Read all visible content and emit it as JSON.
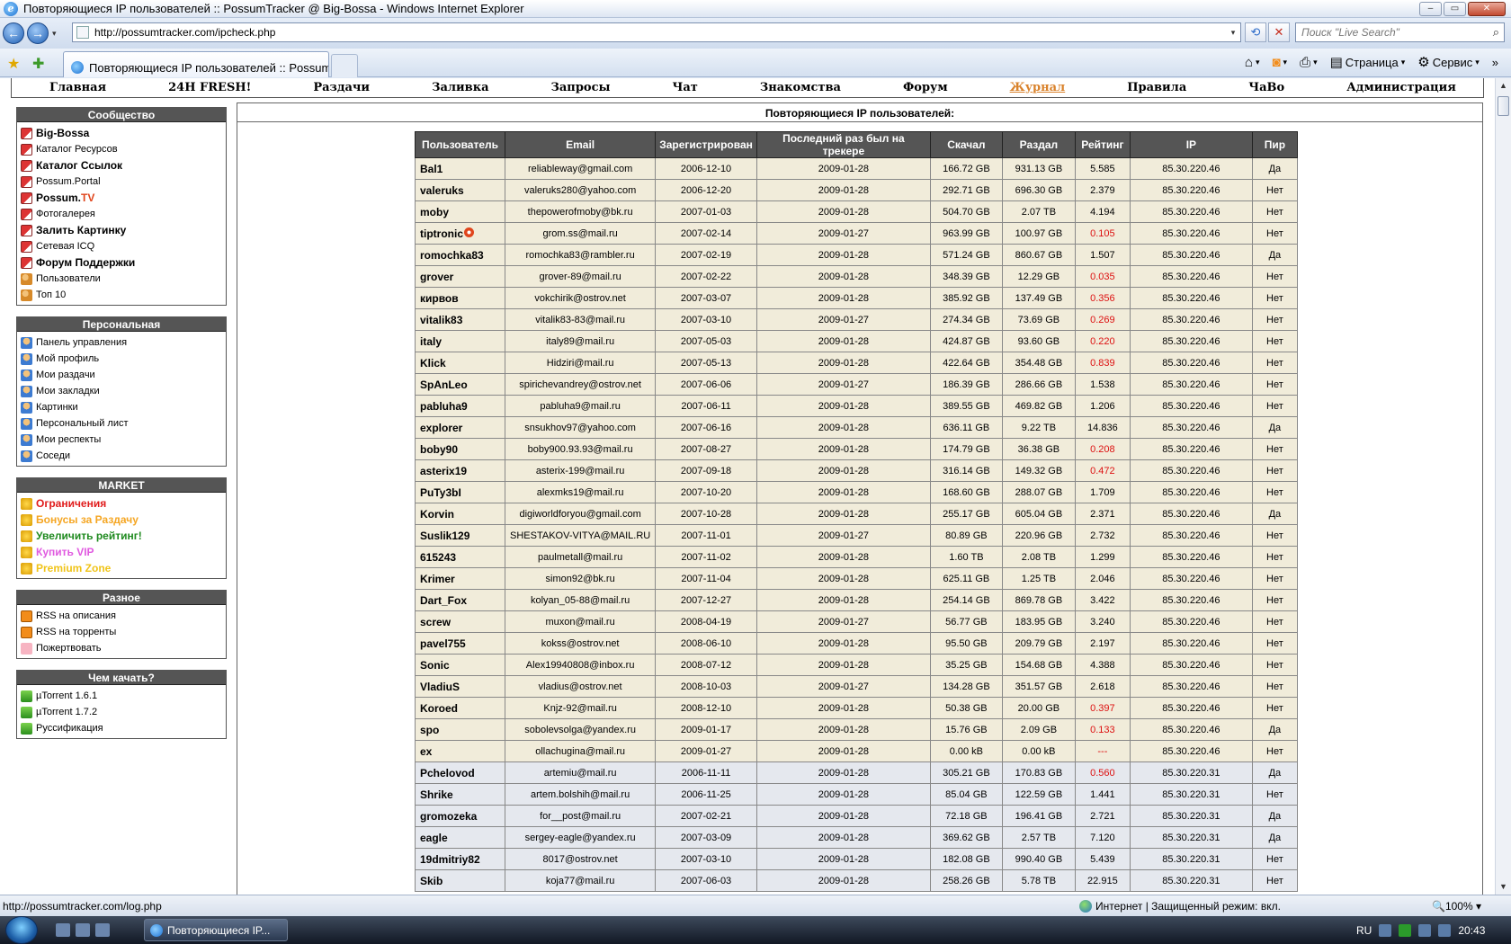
{
  "window": {
    "title": "Повторяющиеся IP пользователей :: PossumTracker @ Big-Bossa - Windows Internet Explorer",
    "min_glyph": "–",
    "max_glyph": "▭",
    "close_glyph": "✕"
  },
  "browser": {
    "back_glyph": "←",
    "forward_glyph": "→",
    "dropdown_glyph": "▾",
    "address": "http://possumtracker.com/ipcheck.php",
    "refresh_glyph": "⟲",
    "stop_glyph": "✕",
    "search_placeholder": "Поиск \"Live Search\"",
    "search_glyph": "⌕",
    "tab_title": "Повторяющиеся IP пользователей :: PossumTr...",
    "commands": {
      "home_glyph": "⌂",
      "feeds_glyph": "◙",
      "print_glyph": "⎙",
      "page_label": "Страница",
      "tools_label": "Сервис",
      "more_glyph": "»"
    },
    "status_url": "http://possumtracker.com/log.php",
    "status_zone": "Интернет | Защищенный режим: вкл.",
    "zoom": "100%"
  },
  "taskbar": {
    "item_label": "Повторяющиеся IP...",
    "lang": "RU",
    "time": "20:43"
  },
  "site_nav": [
    "Главная",
    "24H FRESH!",
    "Раздачи",
    "Заливка",
    "Запросы",
    "Чат",
    "Знакомства",
    "Форум",
    "Журнал",
    "Правила",
    "ЧаВо",
    "Администрация"
  ],
  "sidebar": {
    "community": {
      "title": "Сообщество",
      "items": [
        {
          "label": "Big-Bossa",
          "bold": true,
          "icon": "book-icon"
        },
        {
          "label": "Каталог Ресурсов",
          "bold": false,
          "icon": "book-icon"
        },
        {
          "label": "Каталог Ссылок",
          "bold": true,
          "icon": "book-icon"
        },
        {
          "label": "Possum.Portal",
          "bold": false,
          "icon": "book-icon"
        },
        {
          "label_a": "Possum.",
          "label_b": "TV",
          "bold": true,
          "icon": "book-icon"
        },
        {
          "label": "Фотогалерея",
          "bold": false,
          "icon": "book-icon"
        },
        {
          "label": "Залить Картинку",
          "bold": true,
          "icon": "book-icon"
        },
        {
          "label": "Сетевая ICQ",
          "bold": false,
          "icon": "book-icon"
        },
        {
          "label": "Форум Поддержки",
          "bold": true,
          "icon": "book-icon"
        },
        {
          "label": "Пользователи",
          "bold": false,
          "icon": "users-icon"
        },
        {
          "label": "Топ 10",
          "bold": false,
          "icon": "users-icon"
        }
      ]
    },
    "personal": {
      "title": "Персональная",
      "items": [
        "Панель управления",
        "Мой профиль",
        "Мои раздачи",
        "Мои закладки",
        "Картинки",
        "Персональный лист",
        "Мои респекты",
        "Соседи"
      ]
    },
    "market": {
      "title": "MARKET",
      "items": [
        {
          "label": "Ограничения",
          "color": "#e01b1b"
        },
        {
          "label": "Бонусы за Раздачу",
          "color": "#f5a623"
        },
        {
          "label": "Увеличить рейтинг!",
          "color": "#1f8a1f"
        },
        {
          "label": "Купить VIP",
          "color": "#e05ae0"
        },
        {
          "label": "Premium Zone",
          "color": "#f0c419"
        }
      ]
    },
    "misc": {
      "title": "Разное",
      "items": [
        "RSS на описания",
        "RSS на торренты",
        "Пожертвовать"
      ]
    },
    "start": {
      "title": "Чем качать?",
      "items": [
        "µTorrent 1.6.1",
        "µTorrent 1.7.2",
        "Руссификация"
      ]
    }
  },
  "main": {
    "title": "Повторяющиеся IP пользователей:",
    "columns": [
      "Пользователь",
      "Email",
      "Зарегистрирован",
      "Последний раз был на трекере",
      "Скачал",
      "Раздал",
      "Рейтинг",
      "IP",
      "Пир"
    ],
    "rows": [
      {
        "user": "Bal1",
        "email": "reliableway@gmail.com",
        "reg": "2006-12-10",
        "last": "2009-01-28",
        "down": "166.72 GB",
        "up": "931.13 GB",
        "ratio": "5.585",
        "ip": "85.30.220.46",
        "peer": "Да"
      },
      {
        "user": "valeruks",
        "email": "valeruks280@yahoo.com",
        "reg": "2006-12-20",
        "last": "2009-01-28",
        "down": "292.71 GB",
        "up": "696.30 GB",
        "ratio": "2.379",
        "ip": "85.30.220.46",
        "peer": "Нет"
      },
      {
        "user": "moby",
        "email": "thepowerofmoby@bk.ru",
        "reg": "2007-01-03",
        "last": "2009-01-28",
        "down": "504.70 GB",
        "up": "2.07 TB",
        "ratio": "4.194",
        "ip": "85.30.220.46",
        "peer": "Нет"
      },
      {
        "user": "tiptronic",
        "badge": true,
        "email": "grom.ss@mail.ru",
        "reg": "2007-02-14",
        "last": "2009-01-27",
        "down": "963.99 GB",
        "up": "100.97 GB",
        "ratio": "0.105",
        "ip": "85.30.220.46",
        "peer": "Нет"
      },
      {
        "user": "romochka83",
        "email": "romochka83@rambler.ru",
        "reg": "2007-02-19",
        "last": "2009-01-28",
        "down": "571.24 GB",
        "up": "860.67 GB",
        "ratio": "1.507",
        "ip": "85.30.220.46",
        "peer": "Да"
      },
      {
        "user": "grover",
        "email": "grover-89@mail.ru",
        "reg": "2007-02-22",
        "last": "2009-01-28",
        "down": "348.39 GB",
        "up": "12.29 GB",
        "ratio": "0.035",
        "ip": "85.30.220.46",
        "peer": "Нет"
      },
      {
        "user": "кирвов",
        "email": "vokchirik@ostrov.net",
        "reg": "2007-03-07",
        "last": "2009-01-28",
        "down": "385.92 GB",
        "up": "137.49 GB",
        "ratio": "0.356",
        "ip": "85.30.220.46",
        "peer": "Нет"
      },
      {
        "user": "vitalik83",
        "email": "vitalik83-83@mail.ru",
        "reg": "2007-03-10",
        "last": "2009-01-27",
        "down": "274.34 GB",
        "up": "73.69 GB",
        "ratio": "0.269",
        "ip": "85.30.220.46",
        "peer": "Нет"
      },
      {
        "user": "italy",
        "email": "italy89@mail.ru",
        "reg": "2007-05-03",
        "last": "2009-01-28",
        "down": "424.87 GB",
        "up": "93.60 GB",
        "ratio": "0.220",
        "ip": "85.30.220.46",
        "peer": "Нет"
      },
      {
        "user": "Klick",
        "email": "Hidziri@mail.ru",
        "reg": "2007-05-13",
        "last": "2009-01-28",
        "down": "422.64 GB",
        "up": "354.48 GB",
        "ratio": "0.839",
        "ip": "85.30.220.46",
        "peer": "Нет"
      },
      {
        "user": "SpAnLeo",
        "email": "spirichevandrey@ostrov.net",
        "reg": "2007-06-06",
        "last": "2009-01-27",
        "down": "186.39 GB",
        "up": "286.66 GB",
        "ratio": "1.538",
        "ip": "85.30.220.46",
        "peer": "Нет"
      },
      {
        "user": "pabluha9",
        "email": "pabluha9@mail.ru",
        "reg": "2007-06-11",
        "last": "2009-01-28",
        "down": "389.55 GB",
        "up": "469.82 GB",
        "ratio": "1.206",
        "ip": "85.30.220.46",
        "peer": "Нет"
      },
      {
        "user": "explorer",
        "email": "snsukhov97@yahoo.com",
        "reg": "2007-06-16",
        "last": "2009-01-28",
        "down": "636.11 GB",
        "up": "9.22 TB",
        "ratio": "14.836",
        "ip": "85.30.220.46",
        "peer": "Да"
      },
      {
        "user": "boby90",
        "email": "boby900.93.93@mail.ru",
        "reg": "2007-08-27",
        "last": "2009-01-28",
        "down": "174.79 GB",
        "up": "36.38 GB",
        "ratio": "0.208",
        "ip": "85.30.220.46",
        "peer": "Нет"
      },
      {
        "user": "asterix19",
        "email": "asterix-199@mail.ru",
        "reg": "2007-09-18",
        "last": "2009-01-28",
        "down": "316.14 GB",
        "up": "149.32 GB",
        "ratio": "0.472",
        "ip": "85.30.220.46",
        "peer": "Нет"
      },
      {
        "user": "PuTy3bI",
        "email": "alexmks19@mail.ru",
        "reg": "2007-10-20",
        "last": "2009-01-28",
        "down": "168.60 GB",
        "up": "288.07 GB",
        "ratio": "1.709",
        "ip": "85.30.220.46",
        "peer": "Нет"
      },
      {
        "user": "Korvin",
        "email": "digiworldforyou@gmail.com",
        "reg": "2007-10-28",
        "last": "2009-01-28",
        "down": "255.17 GB",
        "up": "605.04 GB",
        "ratio": "2.371",
        "ip": "85.30.220.46",
        "peer": "Да"
      },
      {
        "user": "Suslik129",
        "email": "SHESTAKOV-VITYA@MAIL.RU",
        "reg": "2007-11-01",
        "last": "2009-01-27",
        "down": "80.89 GB",
        "up": "220.96 GB",
        "ratio": "2.732",
        "ip": "85.30.220.46",
        "peer": "Нет"
      },
      {
        "user": "615243",
        "email": "paulmetall@mail.ru",
        "reg": "2007-11-02",
        "last": "2009-01-28",
        "down": "1.60 TB",
        "up": "2.08 TB",
        "ratio": "1.299",
        "ip": "85.30.220.46",
        "peer": "Нет"
      },
      {
        "user": "Krimer",
        "email": "simon92@bk.ru",
        "reg": "2007-11-04",
        "last": "2009-01-28",
        "down": "625.11 GB",
        "up": "1.25 TB",
        "ratio": "2.046",
        "ip": "85.30.220.46",
        "peer": "Нет"
      },
      {
        "user": "Dart_Fox",
        "email": "kolyan_05-88@mail.ru",
        "reg": "2007-12-27",
        "last": "2009-01-28",
        "down": "254.14 GB",
        "up": "869.78 GB",
        "ratio": "3.422",
        "ip": "85.30.220.46",
        "peer": "Нет"
      },
      {
        "user": "screw",
        "email": "muxon@mail.ru",
        "reg": "2008-04-19",
        "last": "2009-01-27",
        "down": "56.77 GB",
        "up": "183.95 GB",
        "ratio": "3.240",
        "ip": "85.30.220.46",
        "peer": "Нет"
      },
      {
        "user": "pavel755",
        "email": "kokss@ostrov.net",
        "reg": "2008-06-10",
        "last": "2009-01-28",
        "down": "95.50 GB",
        "up": "209.79 GB",
        "ratio": "2.197",
        "ip": "85.30.220.46",
        "peer": "Нет"
      },
      {
        "user": "Sonic",
        "email": "Alex19940808@inbox.ru",
        "reg": "2008-07-12",
        "last": "2009-01-28",
        "down": "35.25 GB",
        "up": "154.68 GB",
        "ratio": "4.388",
        "ip": "85.30.220.46",
        "peer": "Нет"
      },
      {
        "user": "VladiuS",
        "email": "vladius@ostrov.net",
        "reg": "2008-10-03",
        "last": "2009-01-27",
        "down": "134.28 GB",
        "up": "351.57 GB",
        "ratio": "2.618",
        "ip": "85.30.220.46",
        "peer": "Нет"
      },
      {
        "user": "Koroed",
        "email": "Knjz-92@mail.ru",
        "reg": "2008-12-10",
        "last": "2009-01-28",
        "down": "50.38 GB",
        "up": "20.00 GB",
        "ratio": "0.397",
        "ip": "85.30.220.46",
        "peer": "Нет"
      },
      {
        "user": "spo",
        "email": "sobolevsolga@yandex.ru",
        "reg": "2009-01-17",
        "last": "2009-01-28",
        "down": "15.76 GB",
        "up": "2.09 GB",
        "ratio": "0.133",
        "ip": "85.30.220.46",
        "peer": "Да"
      },
      {
        "user": "ex",
        "email": "ollachugina@mail.ru",
        "reg": "2009-01-27",
        "last": "2009-01-28",
        "down": "0.00 kB",
        "up": "0.00 kB",
        "ratio": "---",
        "ip": "85.30.220.46",
        "peer": "Нет"
      },
      {
        "user": "Pchelovod",
        "email": "artemiu@mail.ru",
        "reg": "2006-11-11",
        "last": "2009-01-28",
        "down": "305.21 GB",
        "up": "170.83 GB",
        "ratio": "0.560",
        "ip": "85.30.220.31",
        "peer": "Да"
      },
      {
        "user": "Shrike",
        "email": "artem.bolshih@mail.ru",
        "reg": "2006-11-25",
        "last": "2009-01-28",
        "down": "85.04 GB",
        "up": "122.59 GB",
        "ratio": "1.441",
        "ip": "85.30.220.31",
        "peer": "Нет"
      },
      {
        "user": "gromozeka",
        "email": "for__post@mail.ru",
        "reg": "2007-02-21",
        "last": "2009-01-28",
        "down": "72.18 GB",
        "up": "196.41 GB",
        "ratio": "2.721",
        "ip": "85.30.220.31",
        "peer": "Да"
      },
      {
        "user": "eagle",
        "email": "sergey-eagle@yandex.ru",
        "reg": "2007-03-09",
        "last": "2009-01-28",
        "down": "369.62 GB",
        "up": "2.57 TB",
        "ratio": "7.120",
        "ip": "85.30.220.31",
        "peer": "Да"
      },
      {
        "user": "19dmitriy82",
        "email": "8017@ostrov.net",
        "reg": "2007-03-10",
        "last": "2009-01-28",
        "down": "182.08 GB",
        "up": "990.40 GB",
        "ratio": "5.439",
        "ip": "85.30.220.31",
        "peer": "Нет"
      },
      {
        "user": "Skib",
        "email": "koja77@mail.ru",
        "reg": "2007-06-03",
        "last": "2009-01-28",
        "down": "258.26 GB",
        "up": "5.78 TB",
        "ratio": "22.915",
        "ip": "85.30.220.31",
        "peer": "Нет"
      }
    ]
  }
}
